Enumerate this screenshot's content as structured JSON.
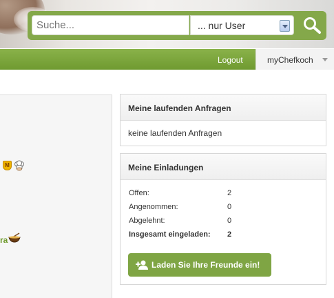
{
  "header": {
    "search": {
      "placeholder": "Suche..."
    },
    "scope_select": {
      "selected": "... nur User"
    }
  },
  "nav": {
    "logout_label": "Logout",
    "my_label": "myChefkoch"
  },
  "left": {
    "badge_letter": "M",
    "partial_name": "ra"
  },
  "requests_card": {
    "title": "Meine laufenden Anfragen",
    "empty_text": "keine laufenden Anfragen"
  },
  "invites_card": {
    "title": "Meine Einladungen",
    "rows": [
      {
        "label": "Offen:",
        "value": "2"
      },
      {
        "label": "Angenommen:",
        "value": "0"
      },
      {
        "label": "Abgelehnt:",
        "value": "0"
      },
      {
        "label": "Insgesamt eingeladen:",
        "value": "2"
      }
    ],
    "button_label": "Laden Sie Ihre Freunde ein!"
  },
  "colors": {
    "accent": "#84a84a",
    "nav_green": "#7aa23b",
    "button_green": "#7fa544"
  },
  "icons": [
    "search-icon",
    "select-arrow-icon",
    "caret-down-icon",
    "moderator-badge-icon",
    "chef-hat-icon",
    "cooking-bowl-icon",
    "add-user-icon"
  ]
}
